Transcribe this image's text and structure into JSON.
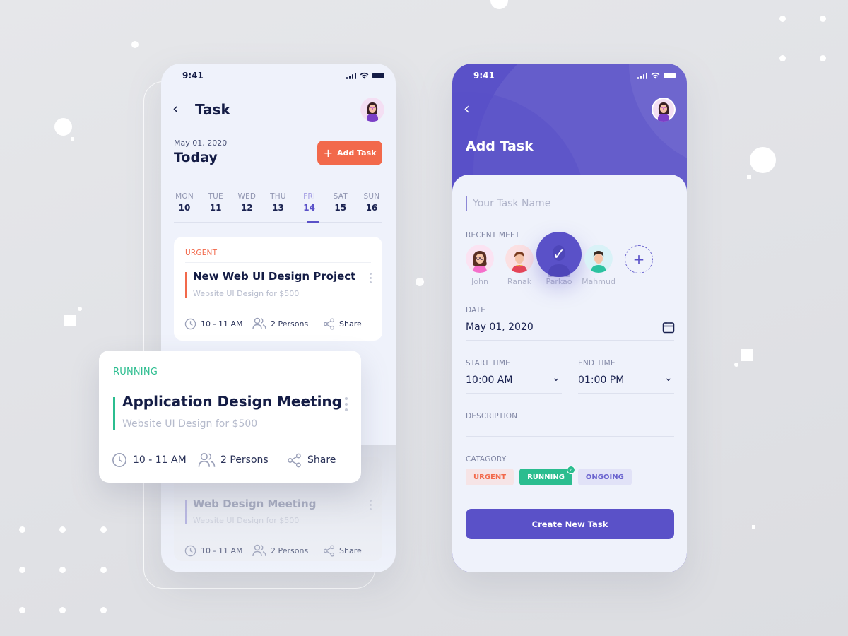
{
  "colors": {
    "primary": "#5a51c8",
    "urgent": "#f2694b",
    "running": "#2bbd8f",
    "ongoing": "#6a63cf",
    "text_dark": "#141c45"
  },
  "task_screen": {
    "status_time": "9:41",
    "title": "Task",
    "date": "May 01, 2020",
    "today_label": "Today",
    "add_task_label": "Add Task",
    "week": [
      {
        "name": "MON",
        "num": "10"
      },
      {
        "name": "TUE",
        "num": "11"
      },
      {
        "name": "WED",
        "num": "12"
      },
      {
        "name": "THU",
        "num": "13"
      },
      {
        "name": "FRI",
        "num": "14",
        "active": true
      },
      {
        "name": "SAT",
        "num": "15"
      },
      {
        "name": "SUN",
        "num": "16"
      }
    ],
    "cards": [
      {
        "tag": "URGENT",
        "title": "New Web UI Design Project",
        "subtitle": "Website UI Design for $500",
        "time": "10 - 11 AM",
        "persons": "2 Persons",
        "share": "Share"
      },
      {
        "tag": "RUNNING",
        "title": "Application Design Meeting",
        "subtitle": "Website UI Design for $500",
        "time": "10 - 11 AM",
        "persons": "2 Persons",
        "share": "Share"
      },
      {
        "tag": "",
        "title": "Web Design Meeting",
        "subtitle": "Website UI Design for $500",
        "time": "10 - 11 AM",
        "persons": "2 Persons",
        "share": "Share"
      }
    ]
  },
  "add_screen": {
    "status_time": "9:41",
    "title": "Add Task",
    "task_name_placeholder": "Your Task Name",
    "recent_meet_label": "RECENT MEET",
    "people": [
      {
        "name": "John"
      },
      {
        "name": "Ranak"
      },
      {
        "name": "Parkao",
        "selected": true
      },
      {
        "name": "Mahmud"
      }
    ],
    "date_label": "DATE",
    "date_value": "May 01, 2020",
    "start_time_label": "START TIME",
    "start_time_value": "10:00 AM",
    "end_time_label": "END TIME",
    "end_time_value": "01:00 PM",
    "description_label": "DESCRIPTION",
    "description_value": "",
    "category_label": "CATAGORY",
    "categories": [
      {
        "label": "URGENT"
      },
      {
        "label": "RUNNING",
        "selected": true
      },
      {
        "label": "ONGOING"
      }
    ],
    "create_label": "Create New Task"
  }
}
